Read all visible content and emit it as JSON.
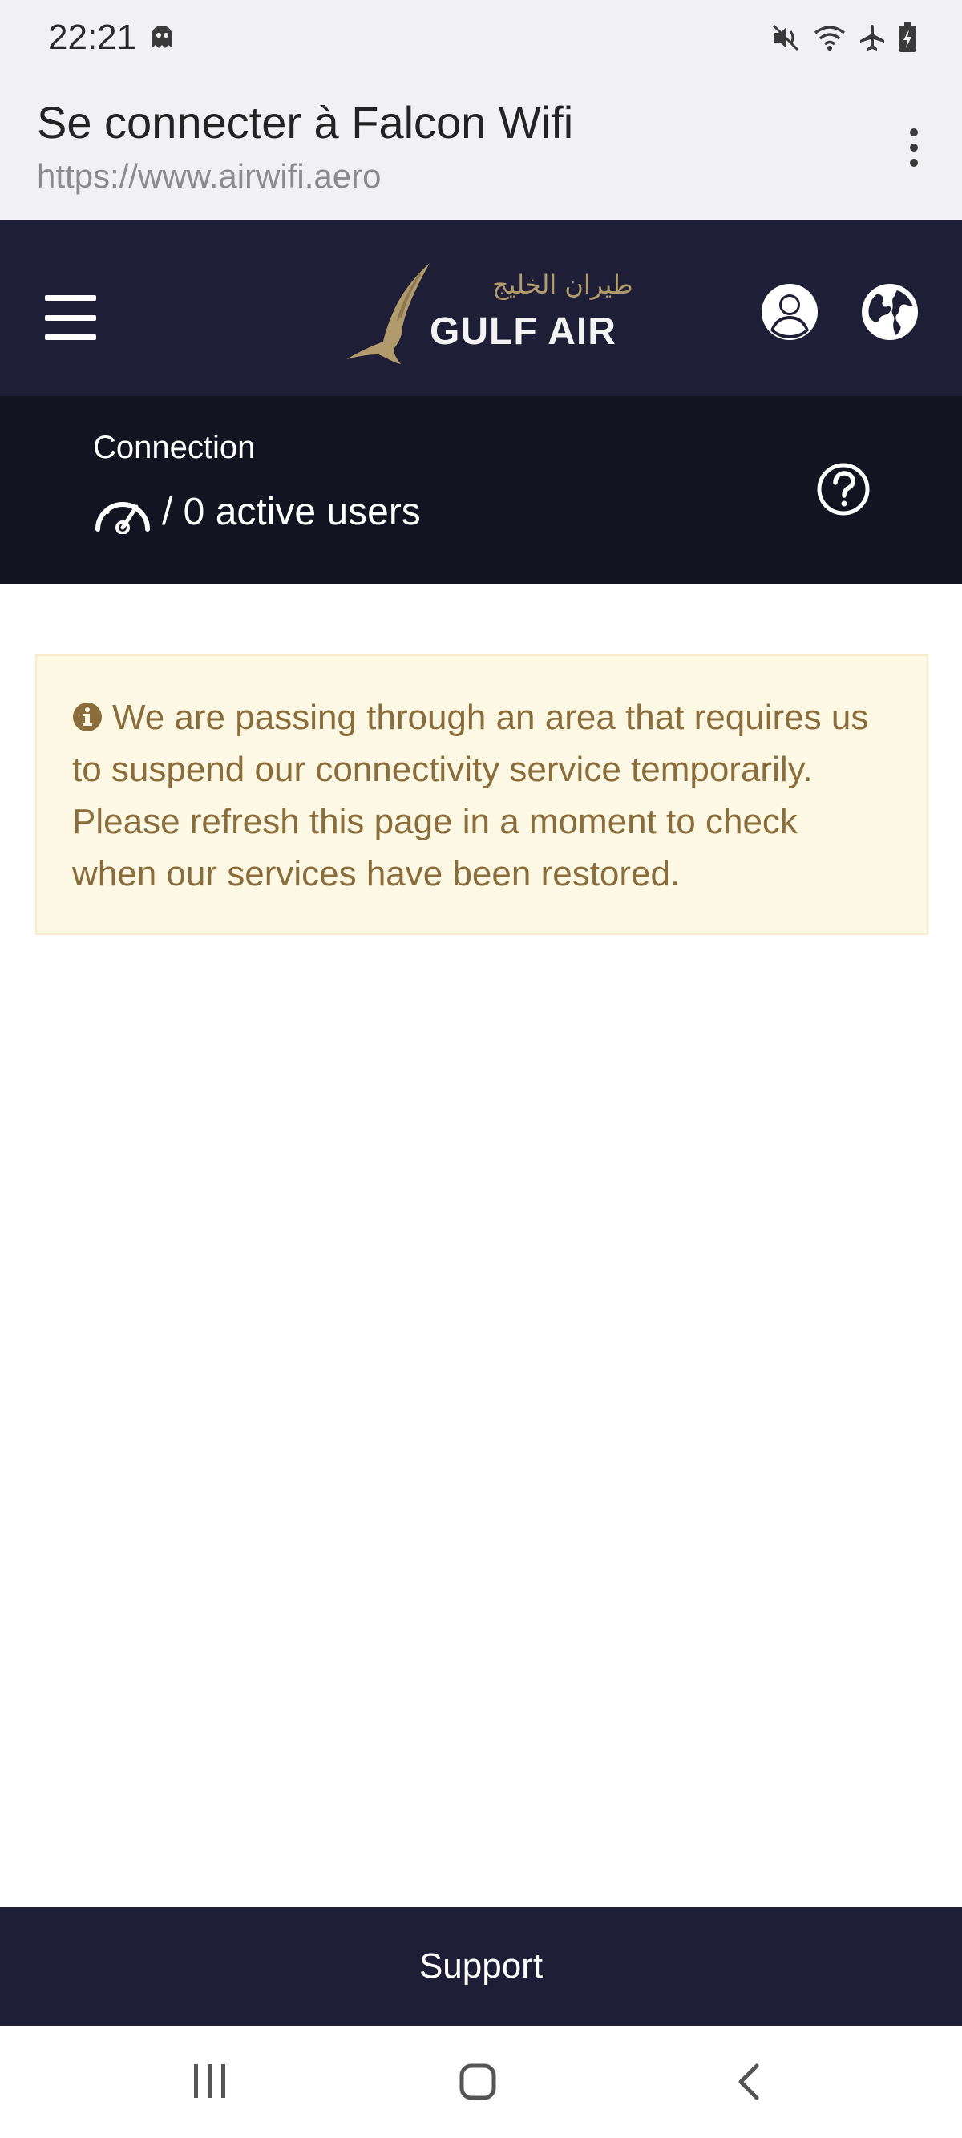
{
  "status_bar": {
    "time": "22:21",
    "left_icon": "ghost-app-icon",
    "icons": [
      "mute-icon",
      "wifi-icon",
      "airplane-mode-icon",
      "battery-charging-icon"
    ]
  },
  "browser": {
    "title": "Se connecter à Falcon Wifi",
    "url": "https://www.airwifi.aero",
    "menu_icon": "more-vert-icon"
  },
  "nav": {
    "menu_icon": "hamburger-icon",
    "logo_arabic": "طيران الخليج",
    "logo_wordmark": "GULF AIR",
    "account_icon": "account-circle-icon",
    "language_icon": "globe-icon"
  },
  "connection": {
    "label": "Connection",
    "status": "/ 0 active users",
    "status_icon": "gauge-icon",
    "help_icon": "help-circle-icon"
  },
  "alert": {
    "icon": "info-circle-icon",
    "message": "We are passing through an area that requires us to suspend our connectivity service temporarily. Please refresh this page in a moment to check when our services have been restored."
  },
  "footer": {
    "support_label": "Support"
  },
  "android_nav": {
    "recents_icon": "recents-icon",
    "home_icon": "home-icon",
    "back_icon": "back-icon"
  },
  "colors": {
    "nav_bg": "#1e1f36",
    "connection_bg": "#131322",
    "alert_bg": "#fcf8e3",
    "alert_text": "#8a6d3b",
    "logo_gold": "#b19a6b"
  }
}
